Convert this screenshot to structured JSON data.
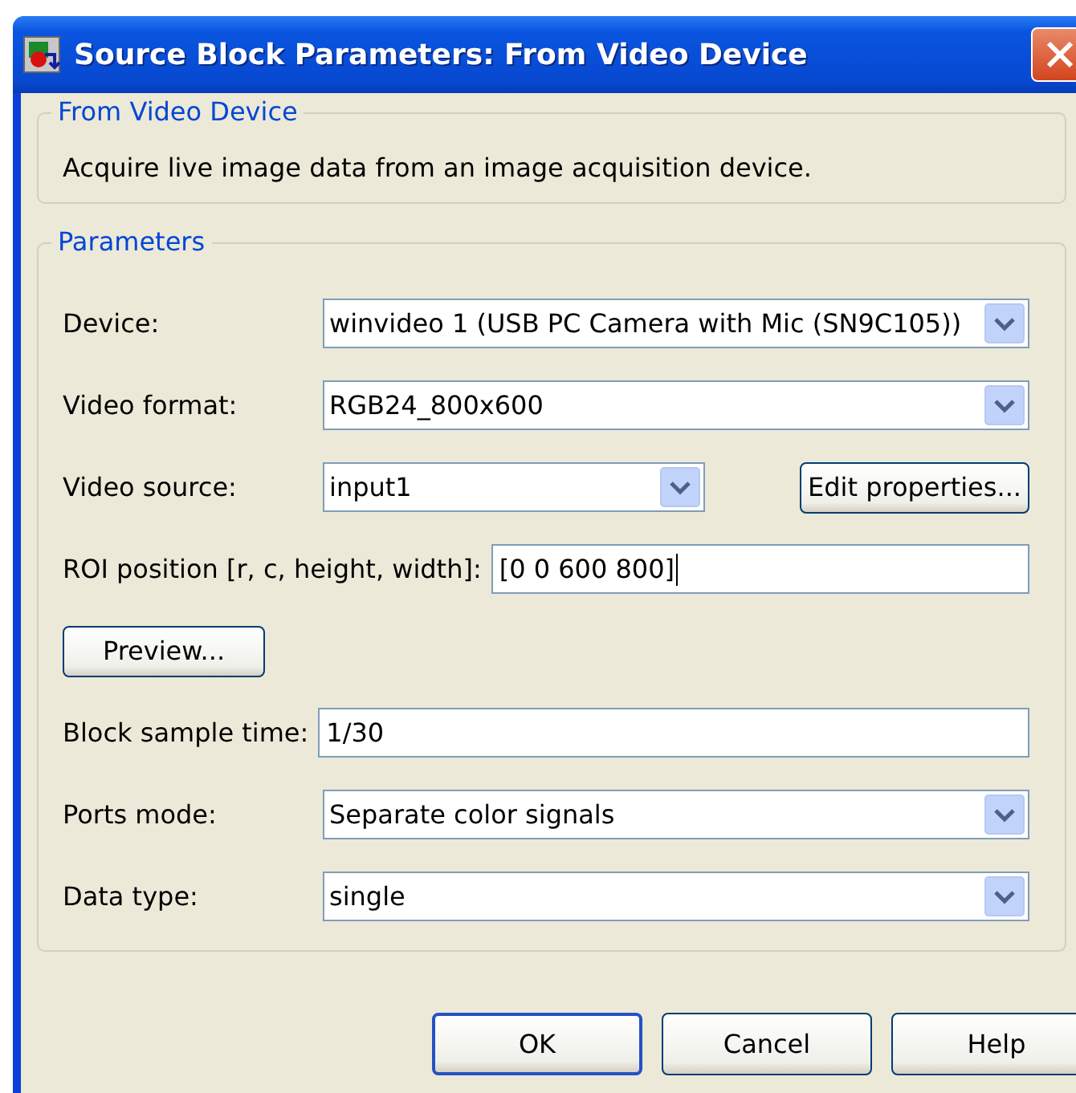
{
  "window": {
    "title": "Source Block Parameters: From Video Device"
  },
  "description_group": {
    "title": "From Video Device",
    "text": "Acquire live image data from an image acquisition device."
  },
  "parameters": {
    "title": "Parameters",
    "rows": [
      {
        "kind": "dropdown",
        "label": "Device:",
        "value": "winvideo 1 (USB PC Camera with Mic (SN9C105))"
      },
      {
        "kind": "dropdown",
        "label": "Video format:",
        "value": "RGB24_800x600"
      },
      {
        "kind": "dropdown_button",
        "label": "Video source:",
        "value": "input1",
        "button": "Edit properties..."
      },
      {
        "kind": "field",
        "label": "ROI position [r, c, height, width]:",
        "value": "[0 0 600 800]",
        "focused": true
      },
      {
        "kind": "button",
        "button": "Preview..."
      },
      {
        "kind": "field",
        "label": "Block sample time:",
        "value": "1/30",
        "focused": false
      },
      {
        "kind": "dropdown",
        "label": "Ports mode:",
        "value": "Separate color signals"
      },
      {
        "kind": "dropdown",
        "label": "Data type:",
        "value": "single"
      }
    ]
  },
  "buttons": [
    {
      "label": "OK",
      "default": true
    },
    {
      "label": "Cancel",
      "default": false
    },
    {
      "label": "Help",
      "default": false
    }
  ]
}
